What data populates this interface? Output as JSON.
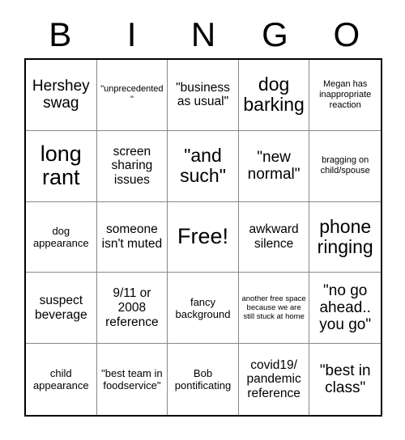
{
  "header": {
    "letters": [
      "B",
      "I",
      "N",
      "G",
      "O"
    ]
  },
  "grid": {
    "rows": [
      [
        {
          "text": "Hershey swag",
          "size": "lg"
        },
        {
          "text": "\"unprecedented\"",
          "size": "xs"
        },
        {
          "text": "\"business as usual\"",
          "size": "md"
        },
        {
          "text": "dog barking",
          "size": "xl"
        },
        {
          "text": "Megan has inappropriate reaction",
          "size": "xs"
        }
      ],
      [
        {
          "text": "long rant",
          "size": "xxl"
        },
        {
          "text": "screen sharing issues",
          "size": "md"
        },
        {
          "text": "\"and such\"",
          "size": "xl"
        },
        {
          "text": "\"new normal\"",
          "size": "lg"
        },
        {
          "text": "bragging on child/spouse",
          "size": "xs"
        }
      ],
      [
        {
          "text": "dog appearance",
          "size": "sm"
        },
        {
          "text": "someone isn't muted",
          "size": "md"
        },
        {
          "text": "Free!",
          "size": "xxl"
        },
        {
          "text": "awkward silence",
          "size": "md"
        },
        {
          "text": "phone ringing",
          "size": "xl"
        }
      ],
      [
        {
          "text": "suspect beverage",
          "size": "md"
        },
        {
          "text": "9/11 or 2008 reference",
          "size": "md"
        },
        {
          "text": "fancy background",
          "size": "sm"
        },
        {
          "text": "another free space because we are still stuck at home",
          "size": "xxs"
        },
        {
          "text": "\"no go ahead.. you go\"",
          "size": "lg"
        }
      ],
      [
        {
          "text": "child appearance",
          "size": "sm"
        },
        {
          "text": "\"best team in foodservice\"",
          "size": "sm"
        },
        {
          "text": "Bob pontificating",
          "size": "sm"
        },
        {
          "text": "covid19/ pandemic reference",
          "size": "md"
        },
        {
          "text": "\"best in class\"",
          "size": "lg"
        }
      ]
    ]
  },
  "colors": {
    "background": "#ffffff",
    "text": "#000000",
    "outer_border": "#000000",
    "inner_border": "#888888"
  }
}
